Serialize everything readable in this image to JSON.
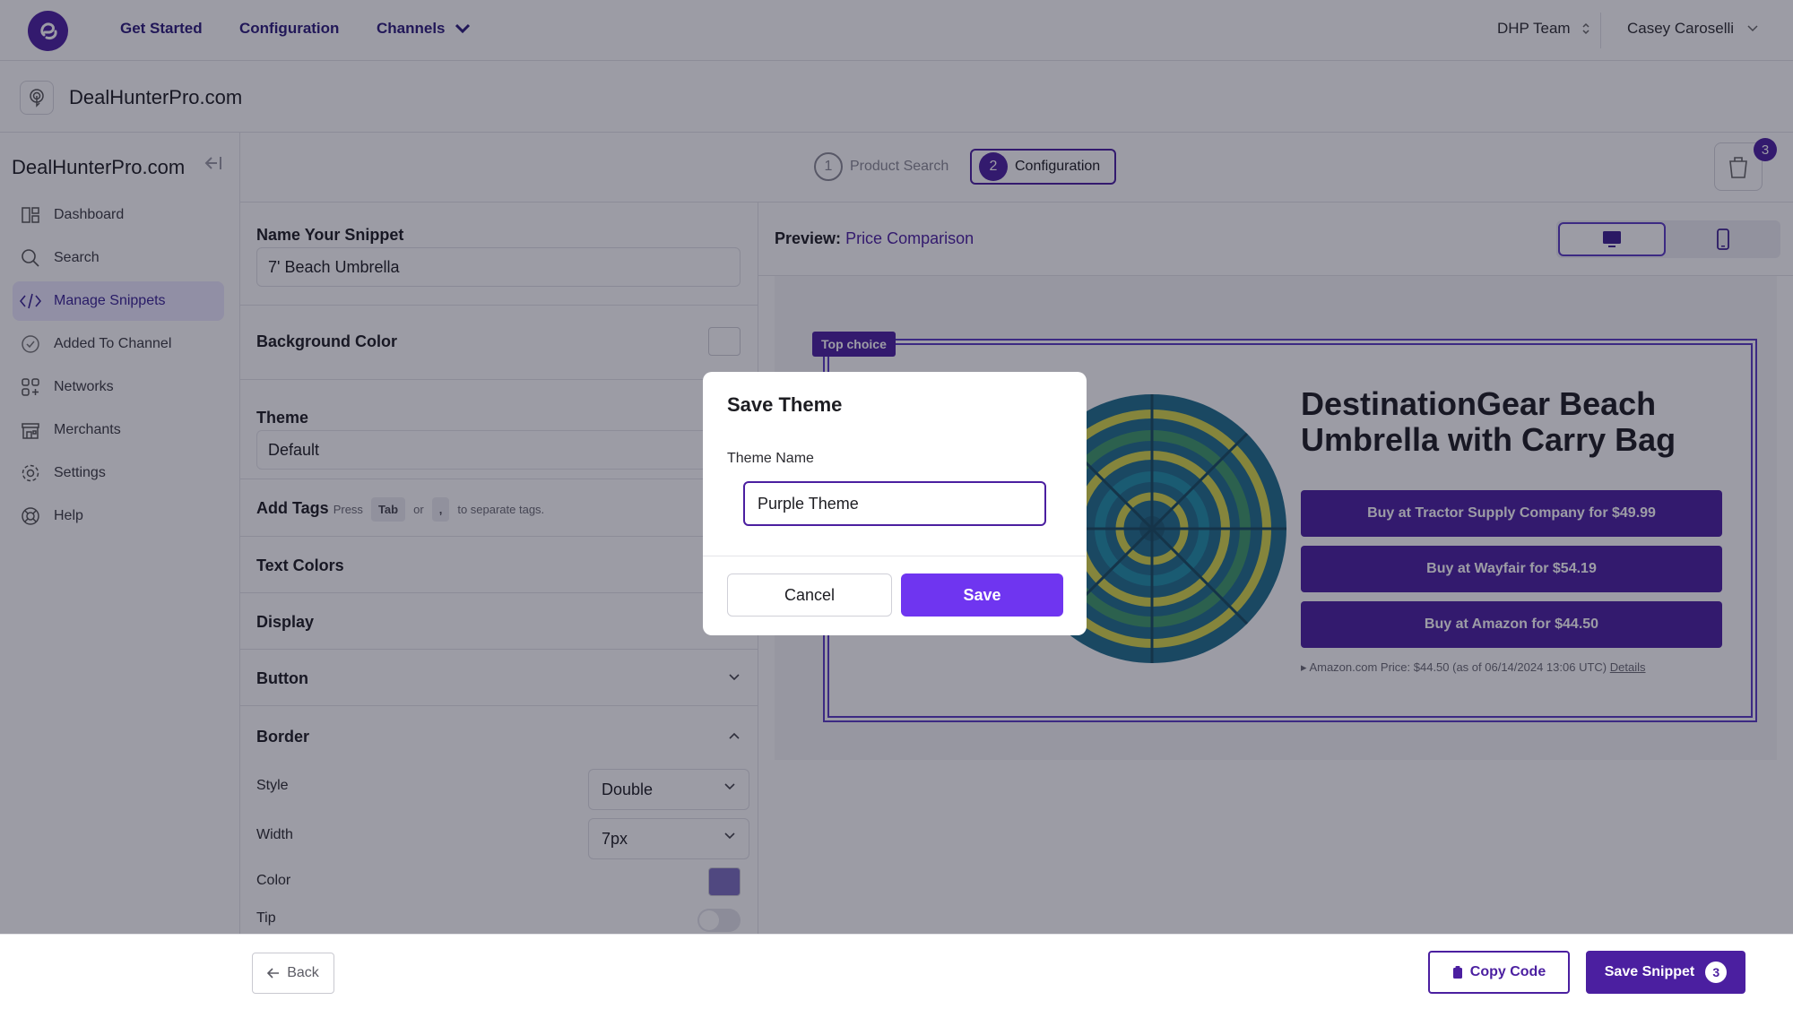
{
  "topnav": {
    "links": [
      "Get Started",
      "Configuration",
      "Channels"
    ],
    "team": "DHP Team",
    "user": "Casey Caroselli"
  },
  "site": {
    "title": "DealHunterPro.com"
  },
  "sidebar": {
    "title": "DealHunterPro.com",
    "items": [
      {
        "label": "Dashboard",
        "icon": "dashboard-icon"
      },
      {
        "label": "Search",
        "icon": "search-icon"
      },
      {
        "label": "Manage Snippets",
        "icon": "code-icon",
        "active": true
      },
      {
        "label": "Added To Channel",
        "icon": "check-circle-icon"
      },
      {
        "label": "Networks",
        "icon": "network-icon"
      },
      {
        "label": "Merchants",
        "icon": "store-icon"
      },
      {
        "label": "Settings",
        "icon": "gear-icon"
      },
      {
        "label": "Help",
        "icon": "help-icon"
      }
    ]
  },
  "steps": {
    "items": [
      {
        "num": "1",
        "label": "Product Search"
      },
      {
        "num": "2",
        "label": "Configuration"
      }
    ],
    "cart_count": "3"
  },
  "config": {
    "name_label": "Name Your Snippet",
    "name_value": "7' Beach Umbrella",
    "background_label": "Background Color",
    "theme_label": "Theme",
    "theme_value": "Default",
    "tags_label": "Add Tags",
    "tags_hint_press": "Press",
    "tags_hint_key1": "Tab",
    "tags_hint_or": "or",
    "tags_hint_key2": ",",
    "tags_hint_rest": "to separate tags.",
    "text_colors_label": "Text Colors",
    "display_label": "Display",
    "button_label": "Button",
    "border_label": "Border",
    "style_label": "Style",
    "style_value": "Double",
    "width_label": "Width",
    "width_value": "7px",
    "color_label": "Color",
    "tip_label": "Tip",
    "border_color": "#7d6fc0"
  },
  "preview": {
    "title_prefix": "Preview:",
    "title_value": "Price Comparison",
    "badge": "Top choice",
    "product_title": "DestinationGear Beach Umbrella with Carry Bag",
    "buttons": [
      "Buy at Tractor Supply Company for $49.99",
      "Buy at Wayfair for $54.19",
      "Buy at Amazon for $44.50"
    ],
    "price_note": "Amazon.com Price: $44.50 (as of 06/14/2024 13:06 UTC)",
    "details_link": "Details"
  },
  "modal": {
    "title": "Save Theme",
    "label": "Theme Name",
    "input_value": "Purple Theme",
    "cancel": "Cancel",
    "save": "Save"
  },
  "footer": {
    "back": "Back",
    "copy": "Copy Code",
    "save": "Save Snippet",
    "save_count": "3"
  },
  "colors": {
    "brand": "#4b1fa0",
    "accent": "#6f35f0"
  }
}
